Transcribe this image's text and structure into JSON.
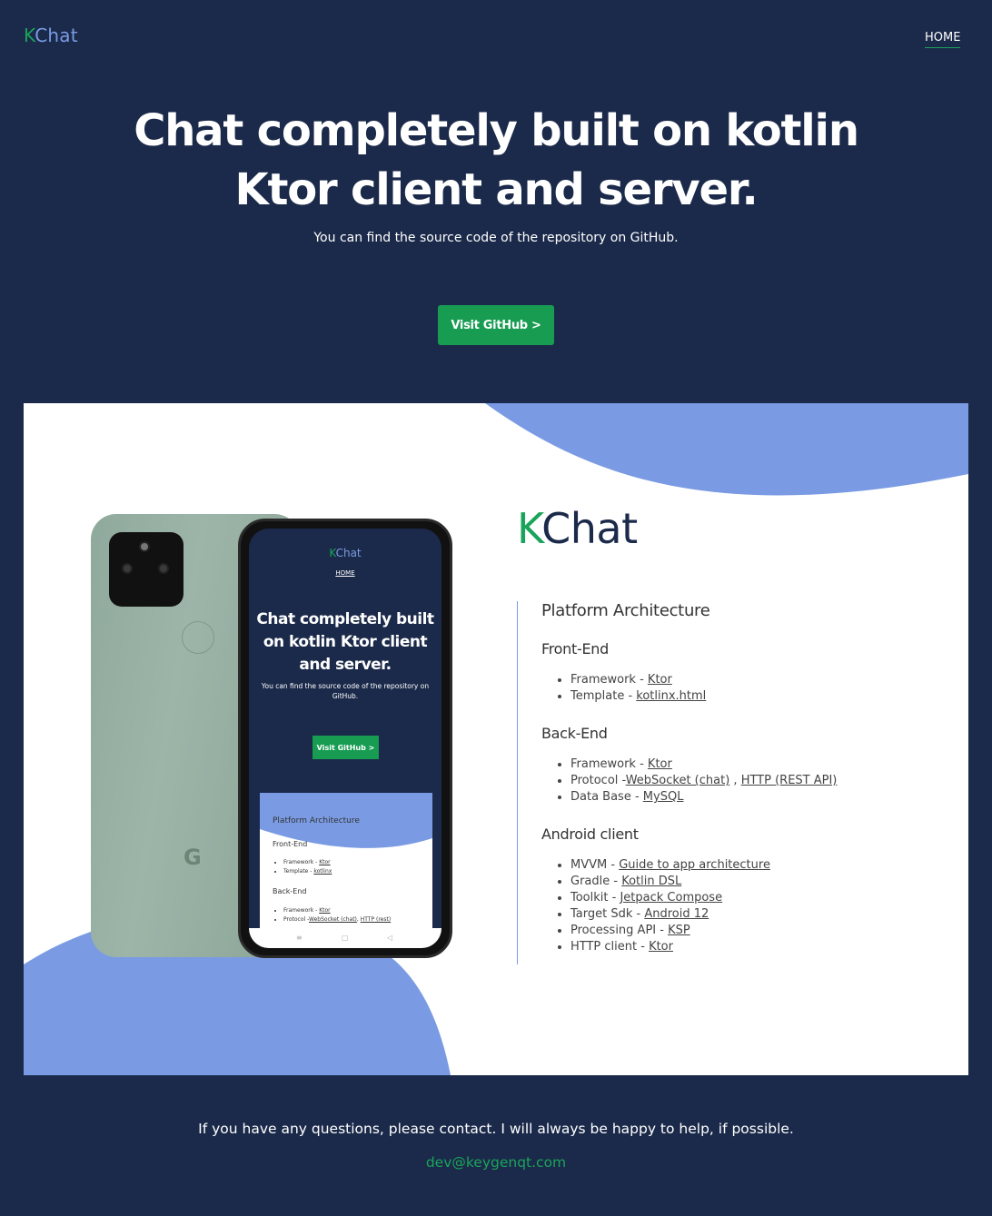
{
  "brand": {
    "k": "K",
    "rest": "Chat"
  },
  "nav": {
    "home_label": "HOME"
  },
  "hero": {
    "title_line1": "Chat completely built on kotlin",
    "title_line2": "Ktor client and server.",
    "subtitle": "You can find the source code of the repository on GitHub.",
    "cta_label": "Visit GitHub >"
  },
  "mockup": {
    "title": "Chat completely built on kotlin Ktor client and server.",
    "subtitle": "You can find the source code of the repository on GitHub.",
    "cta_label": "Visit GitHub >",
    "panel_title": "Platform Architecture",
    "frontend_title": "Front-End",
    "frontend_items": [
      {
        "label": "Framework - ",
        "link": "Ktor"
      },
      {
        "label": "Template - ",
        "link": "kotlinx"
      }
    ],
    "backend_title": "Back-End",
    "backend_items": [
      {
        "label": "Framework - ",
        "link": "Ktor"
      },
      {
        "label": "Protocol -",
        "link": "WebSocket (chat)",
        "sep": ", ",
        "link2": "HTTP (rest)"
      }
    ]
  },
  "architecture": {
    "title": "Platform Architecture",
    "frontend": {
      "title": "Front-End",
      "items": [
        {
          "label": "Framework - ",
          "link": "Ktor"
        },
        {
          "label": "Template - ",
          "link": "kotlinx.html"
        }
      ]
    },
    "backend": {
      "title": "Back-End",
      "items": [
        {
          "label": "Framework - ",
          "link": "Ktor"
        },
        {
          "label": "Protocol -",
          "link": "WebSocket (chat)",
          "sep": " , ",
          "link2": "HTTP (REST API)"
        },
        {
          "label": "Data Base - ",
          "link": "MySQL"
        }
      ]
    },
    "android": {
      "title": "Android client",
      "items": [
        {
          "label": "MVVM - ",
          "link": "Guide to app architecture"
        },
        {
          "label": "Gradle - ",
          "link": "Kotlin DSL"
        },
        {
          "label": "Toolkit - ",
          "link": "Jetpack Compose"
        },
        {
          "label": "Target Sdk - ",
          "link": "Android 12"
        },
        {
          "label": "Processing API - ",
          "link": "KSP"
        },
        {
          "label": "HTTP client - ",
          "link": "Ktor"
        }
      ]
    }
  },
  "footer": {
    "text": "If you have any questions, please contact. I will always be happy to help, if possible.",
    "email": "dev@keygenqt.com"
  },
  "colors": {
    "background": "#1b2a4a",
    "accent_green": "#1aa35a",
    "accent_blue": "#7a9be3",
    "button_green": "#179c52"
  }
}
